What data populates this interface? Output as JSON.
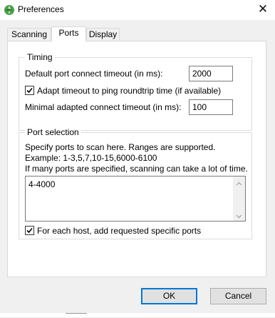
{
  "window": {
    "title": "Preferences",
    "close_glyph": "✕"
  },
  "tabs": [
    {
      "label": "Scanning",
      "active": false
    },
    {
      "label": "Ports",
      "active": true
    },
    {
      "label": "Display",
      "active": false
    }
  ],
  "timing": {
    "title": "Timing",
    "default_timeout_label": "Default port connect timeout (in ms):",
    "default_timeout_value": "2000",
    "adapt_label": "Adapt timeout to ping roundtrip time (if available)",
    "adapt_checked": true,
    "min_timeout_label": "Minimal adapted connect timeout (in ms):",
    "min_timeout_value": "100"
  },
  "port_selection": {
    "title": "Port selection",
    "help_line1": "Specify ports to scan here. Ranges are supported.",
    "help_line2": "Example: 1-3,5,7,10-15,6000-6100",
    "help_line3": "If many ports are specified, scanning can take a lot of time.",
    "ports_value": "4-4000",
    "add_specific_label": "For each host, add requested specific ports",
    "add_specific_checked": true
  },
  "buttons": {
    "ok": "OK",
    "cancel": "Cancel"
  },
  "colors": {
    "accent": "#0078d7",
    "panel_bg": "#ffffff",
    "window_bg": "#f0f0f0"
  },
  "icons": {
    "app": "ipscan-leaf-icon",
    "check": "checkmark-icon"
  }
}
